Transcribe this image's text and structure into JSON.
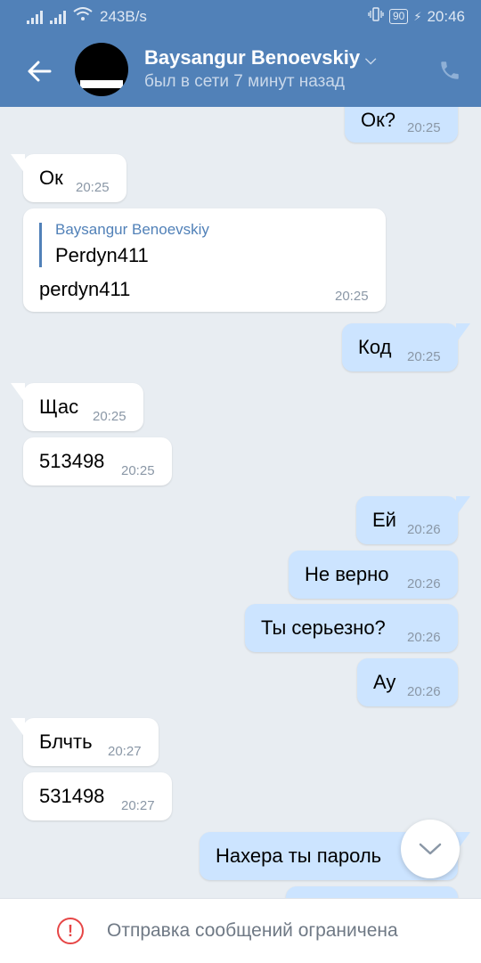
{
  "status_bar": {
    "net_speed": "243B/s",
    "battery": "90",
    "time": "20:46"
  },
  "header": {
    "contact_name": "Baysangur Benoevskiy",
    "last_seen": "был в сети 7 минут назад",
    "icons": {
      "back": "arrow-left-icon",
      "dropdown": "chevron-down-icon",
      "call": "phone-icon"
    }
  },
  "messages": [
    {
      "dir": "out",
      "text": "Ок?",
      "time": "20:25"
    },
    {
      "dir": "in",
      "text": "Ок",
      "time": "20:25"
    },
    {
      "dir": "in",
      "forwarded_from": "Baysangur Benoevskiy",
      "forwarded_text": "Perdyn411",
      "text": "perdyn411",
      "time": "20:25"
    },
    {
      "dir": "out",
      "text": "Код",
      "time": "20:25"
    },
    {
      "dir": "in",
      "text": "Щас",
      "time": "20:25"
    },
    {
      "dir": "in",
      "text": "513498",
      "time": "20:25"
    },
    {
      "dir": "out",
      "text": "Ей",
      "time": "20:26"
    },
    {
      "dir": "out",
      "text": "Не верно",
      "time": "20:26"
    },
    {
      "dir": "out",
      "text": "Ты серьезно?",
      "time": "20:26"
    },
    {
      "dir": "out",
      "text": "Ау",
      "time": "20:26"
    },
    {
      "dir": "in",
      "text": "Блчть",
      "time": "20:27"
    },
    {
      "dir": "in",
      "text": "531498",
      "time": "20:27"
    },
    {
      "dir": "out",
      "text": "Нахера ты пароль",
      "time": ""
    }
  ],
  "footer": {
    "restriction_text": "Отправка сообщений ограничена",
    "icon": "warning-circle-icon"
  },
  "colors": {
    "header_bg": "#5181b8",
    "outgoing_bubble": "#cce4ff",
    "incoming_bubble": "#ffffff",
    "chat_bg": "#e8edf2",
    "warning": "#e64646"
  }
}
